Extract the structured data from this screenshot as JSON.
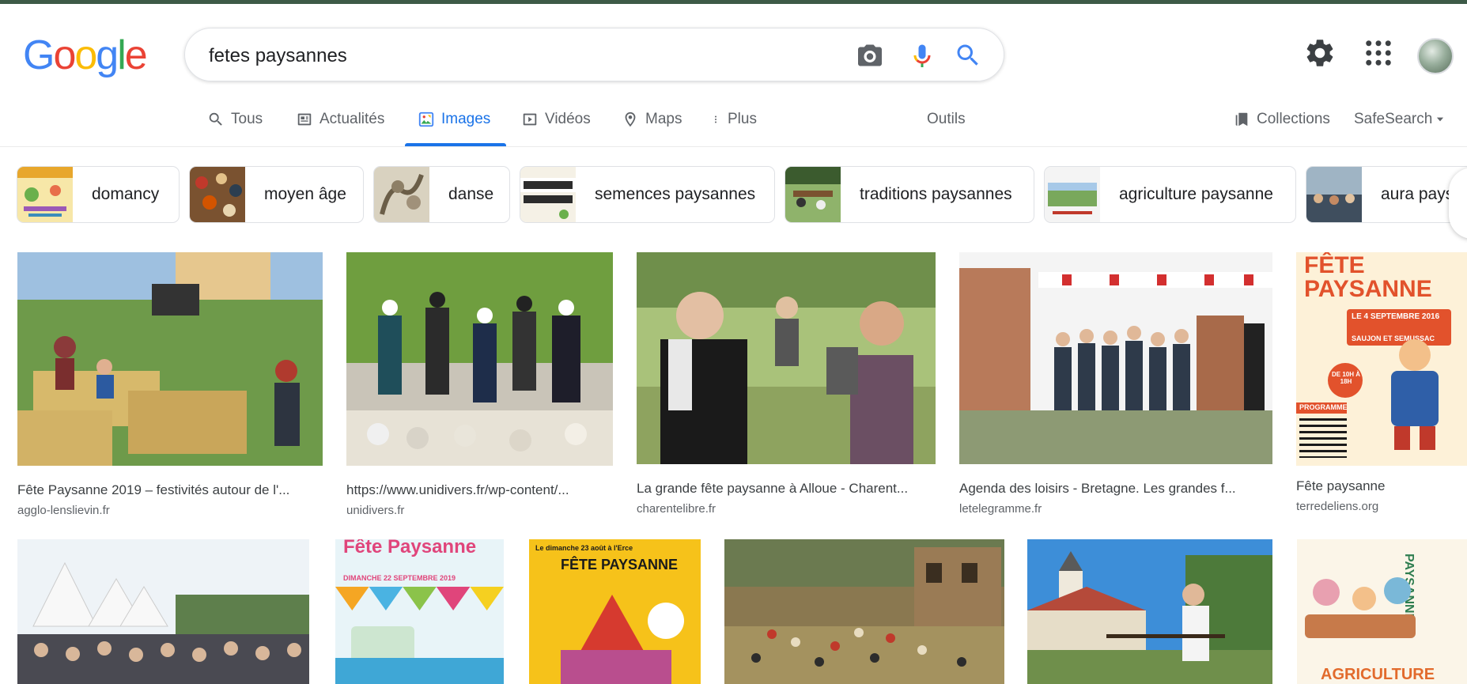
{
  "search": {
    "query": "fetes paysannes"
  },
  "logo": {
    "letters": [
      "G",
      "o",
      "o",
      "g",
      "l",
      "e"
    ],
    "colors": [
      "#4285f4",
      "#ea4335",
      "#fbbc05",
      "#4285f4",
      "#34a853",
      "#ea4335"
    ]
  },
  "tabs": {
    "tous": "Tous",
    "actualites": "Actualités",
    "images": "Images",
    "videos": "Vidéos",
    "maps": "Maps",
    "plus": "Plus",
    "outils": "Outils",
    "collections": "Collections",
    "safesearch": "SafeSearch"
  },
  "chips": [
    {
      "label": "domancy"
    },
    {
      "label": "moyen âge"
    },
    {
      "label": "danse"
    },
    {
      "label": "semences paysannes"
    },
    {
      "label": "traditions paysannes"
    },
    {
      "label": "agriculture paysanne"
    },
    {
      "label": "aura pays"
    }
  ],
  "results": [
    {
      "title": "Fête Paysanne 2019 – festivités autour de l'...",
      "source": "agglo-lenslievin.fr"
    },
    {
      "title": "https://www.unidivers.fr/wp-content/...",
      "source": "unidivers.fr"
    },
    {
      "title": "La grande fête paysanne à Alloue - Charent...",
      "source": "charentelibre.fr"
    },
    {
      "title": "Agenda des loisirs - Bretagne. Les grandes f...",
      "source": "letelegramme.fr"
    },
    {
      "title": "Fête paysanne",
      "source": "terredeliens.org"
    }
  ],
  "poster_texts": {
    "p5_title": "FÊTE PAYSANNE",
    "p5_date": "LE 4 SEPTEMBRE 2016",
    "p5_place": "SAUJON ET SEMUSSAC",
    "p5_hours": "DE 10H À 18H",
    "p5_programme": "PROGRAMME",
    "r2b_title": "Fête Paysanne",
    "r2b_date": "DIMANCHE 22 SEPTEMBRE 2019",
    "r2c_title": "FÊTE PAYSANNE",
    "r2c_date": "Le dimanche 23 août à l'Erce",
    "r2f_title": "PAYSANNES",
    "r2f_sub": "AGRICULTURE"
  }
}
